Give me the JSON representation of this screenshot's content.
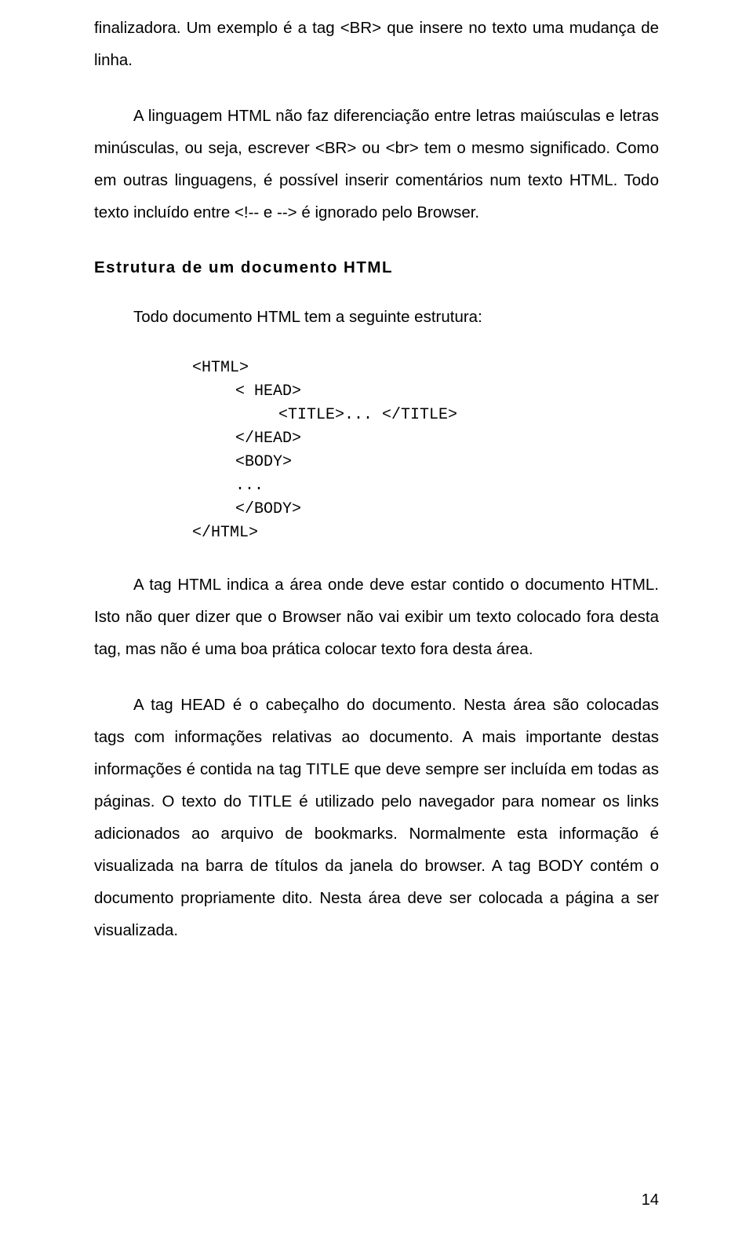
{
  "para1": "finalizadora. Um exemplo é a tag <BR> que insere no texto uma mudança de linha.",
  "para2": "A linguagem HTML não faz diferenciação entre letras maiúsculas e letras minúsculas, ou seja, escrever <BR> ou <br> tem o mesmo significado. Como em outras linguagens, é possível inserir comentários num texto HTML. Todo texto incluído entre <!-- e --> é ignorado pelo Browser.",
  "heading1": "Estrutura de um documento HTML",
  "para3": "Todo documento HTML tem a seguinte estrutura:",
  "code": {
    "l1": "<HTML>",
    "l2": "< HEAD>",
    "l3": "<TITLE>... </TITLE>",
    "l4": "</HEAD>",
    "l5": "<BODY>",
    "l6": "...",
    "l7": "</BODY>",
    "l8": "</HTML>"
  },
  "para4": "A tag HTML indica a área onde deve estar contido o documento HTML. Isto não quer dizer que o Browser não vai exibir um texto colocado fora desta tag, mas não é uma boa prática colocar texto fora desta área.",
  "para5": "A tag HEAD é o cabeçalho do documento. Nesta área são colocadas tags com informações relativas ao documento. A mais importante destas informações é contida na tag TITLE que deve sempre ser incluída em todas as páginas. O texto do TITLE é utilizado pelo navegador para nomear os links adicionados ao arquivo de bookmarks. Normalmente esta informação é visualizada na barra de títulos da janela do browser. A tag BODY contém o documento propriamente dito. Nesta área deve ser colocada a página a ser visualizada.",
  "pageNumber": "14"
}
